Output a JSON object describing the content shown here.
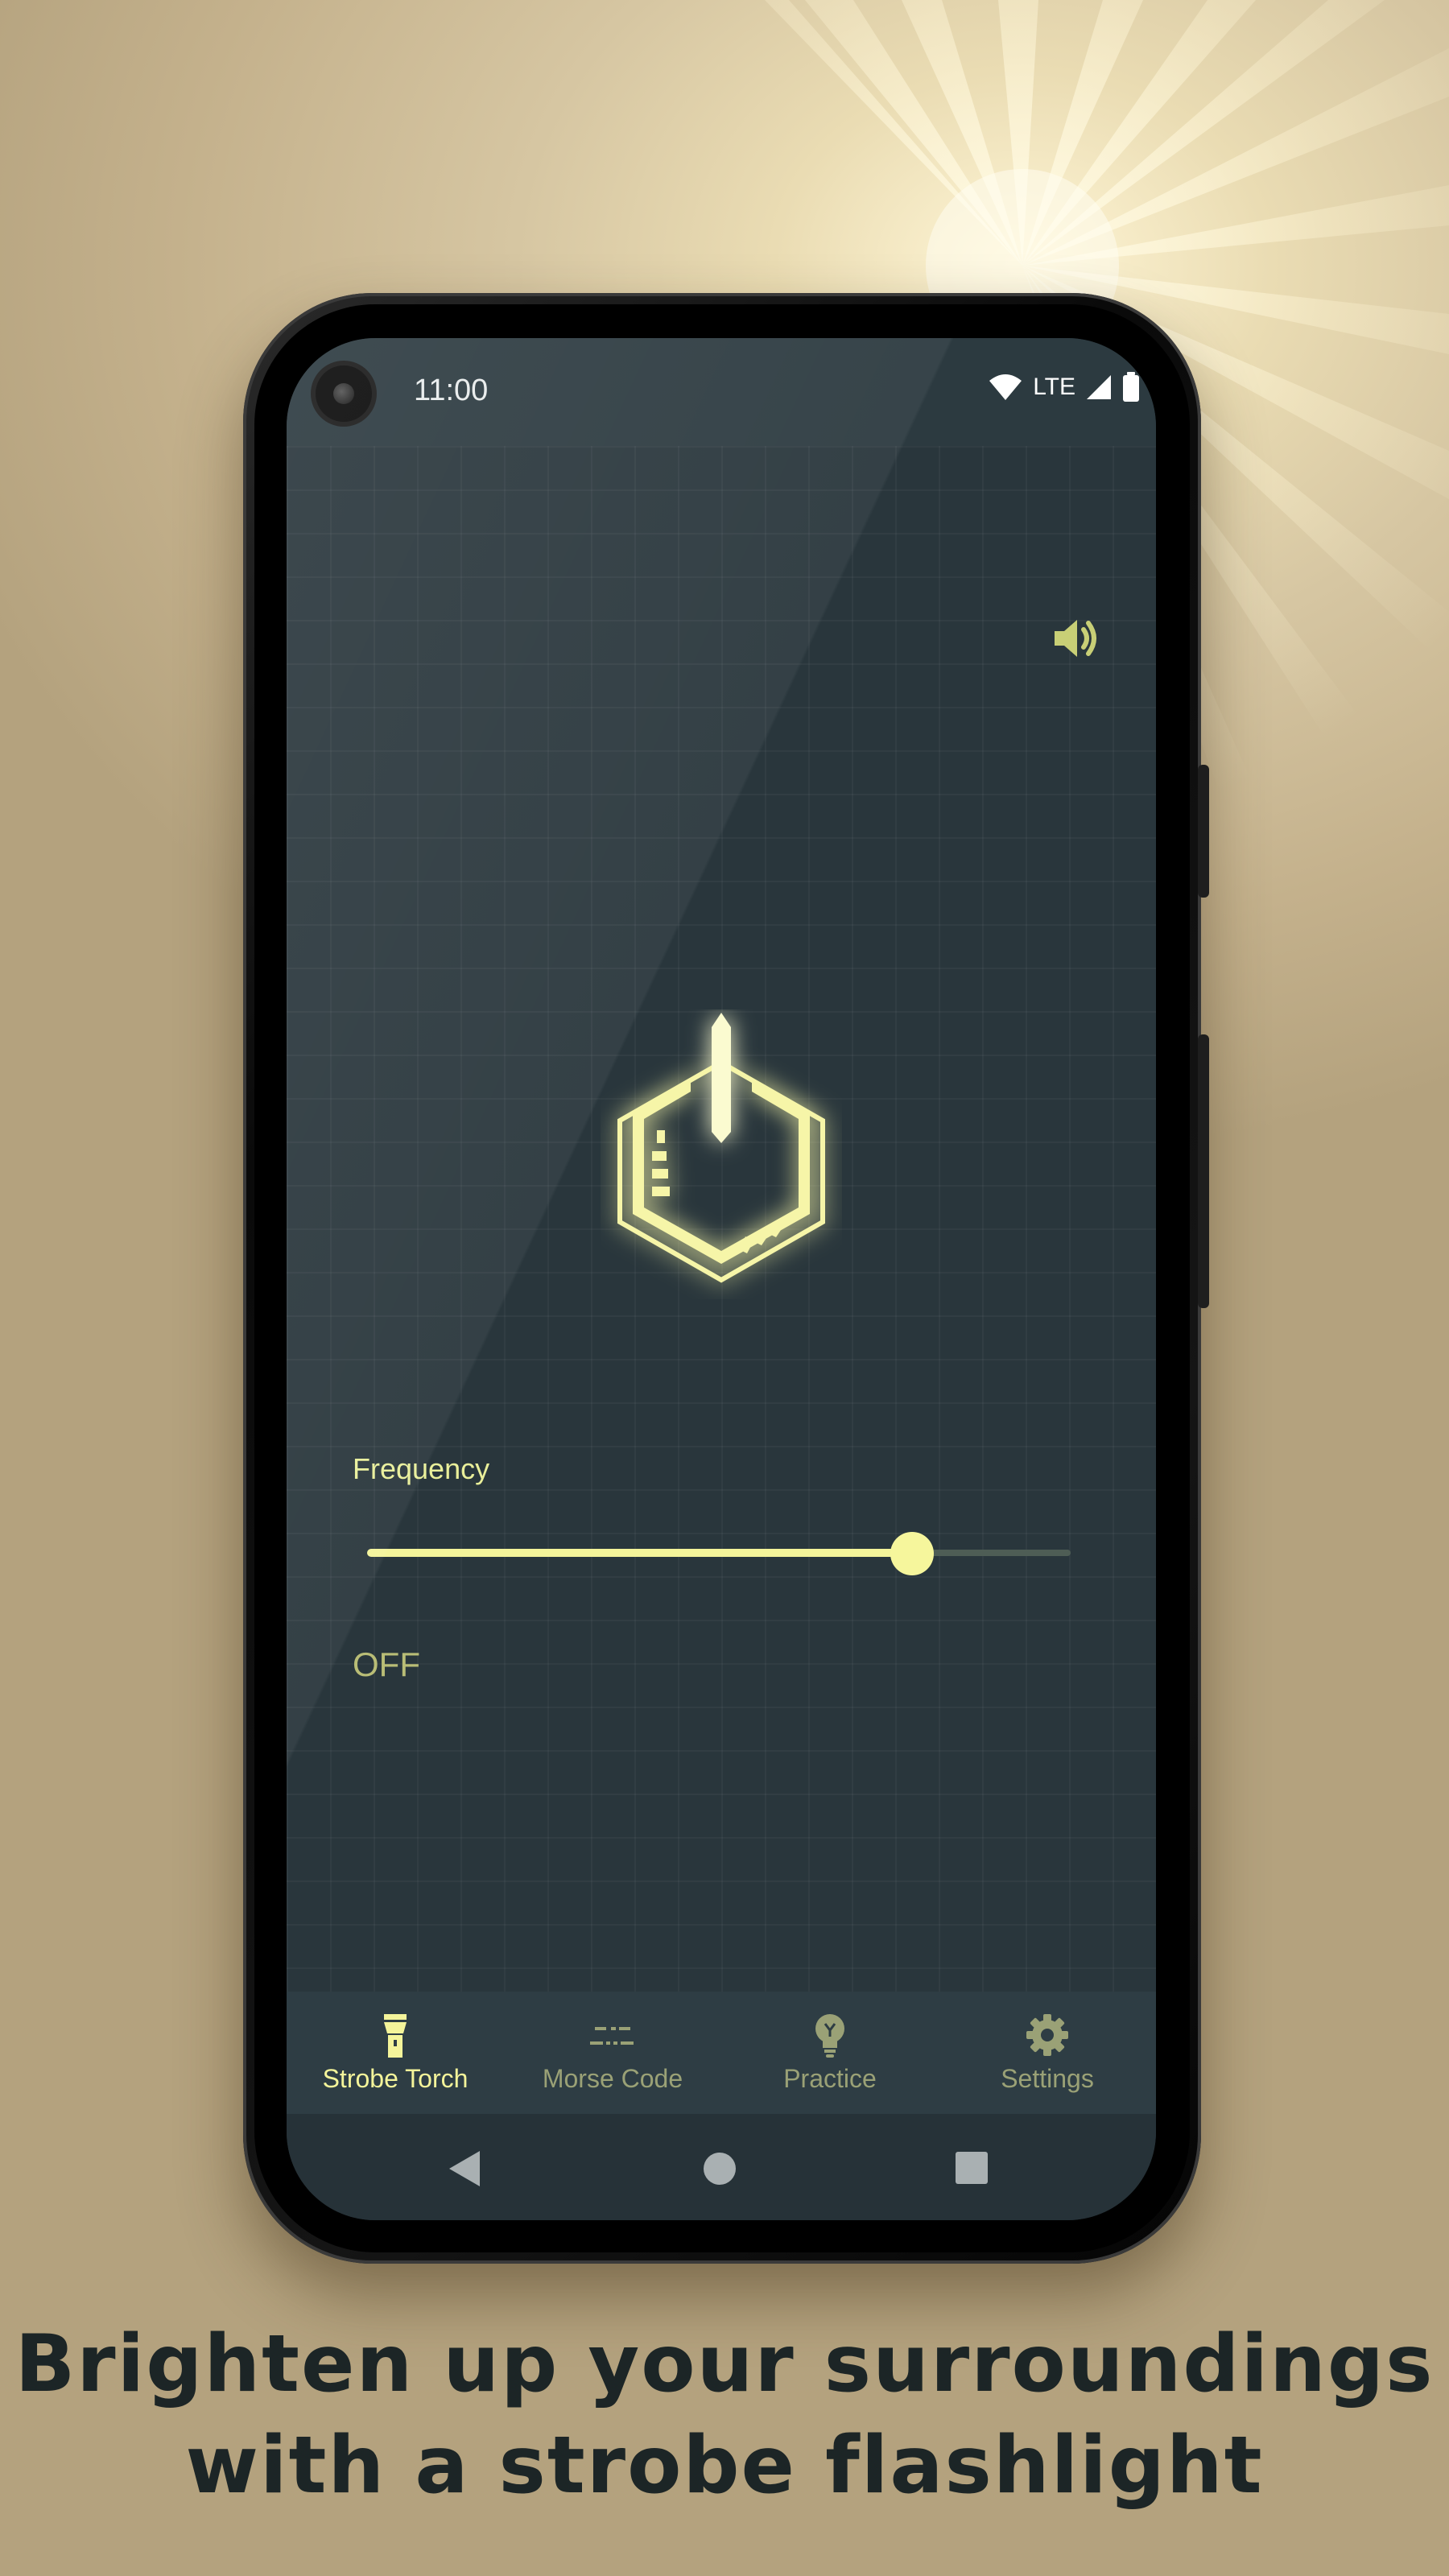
{
  "status_bar": {
    "time": "11:00",
    "network": "LTE",
    "icons": [
      "wifi-icon",
      "cell-signal-icon",
      "battery-icon"
    ]
  },
  "header": {
    "sound_icon": "speaker-icon"
  },
  "main": {
    "power_button_icon": "hexagon-power-icon",
    "frequency": {
      "label": "Frequency",
      "value_fraction": 0.775
    },
    "state": "OFF"
  },
  "bottom_nav": {
    "items": [
      {
        "label": "Strobe Torch",
        "icon": "flashlight-icon",
        "active": true
      },
      {
        "label": "Morse Code",
        "icon": "morse-dash-dot-icon",
        "active": false
      },
      {
        "label": "Practice",
        "icon": "lightbulb-icon",
        "active": false
      },
      {
        "label": "Settings",
        "icon": "gear-icon",
        "active": false
      }
    ]
  },
  "system_nav": {
    "icons": [
      "back-icon",
      "home-icon",
      "recents-icon"
    ]
  },
  "caption": {
    "line1": "Brighten up your surroundings",
    "line2": "with a strobe flashlight"
  },
  "colors": {
    "accent": "#f4f49a",
    "inactive": "#9aa176",
    "screen_bg": "#29363c",
    "nav_bg": "#2e3d44"
  }
}
